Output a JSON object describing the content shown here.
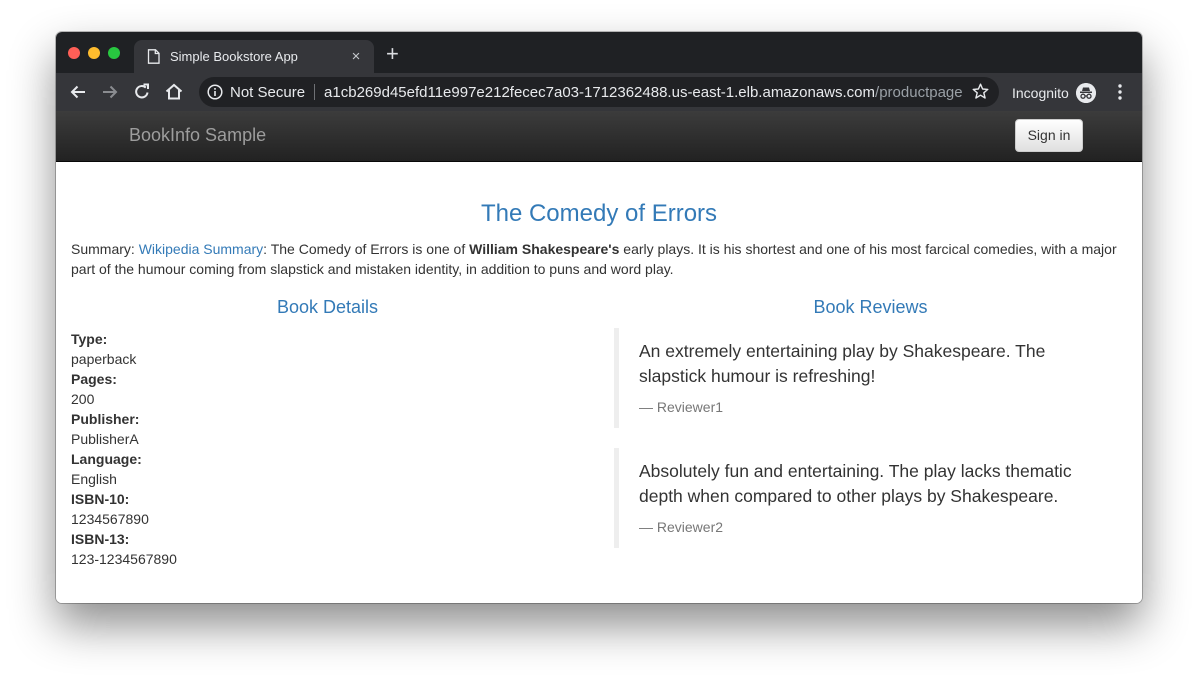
{
  "browser": {
    "tab_title": "Simple Bookstore App",
    "tab_close": "×",
    "new_tab": "+",
    "security_label": "Not Secure",
    "url_host": "a1cb269d45efd11e997e212fecec7a03-1712362488.us-east-1.elb.amazonaws.com",
    "url_path": "/productpage",
    "incognito_label": "Incognito",
    "traffic_light_colors": [
      "#ff5f57",
      "#febc2e",
      "#28c840"
    ]
  },
  "navbar": {
    "brand": "BookInfo Sample",
    "signin_label": "Sign in"
  },
  "book": {
    "title": "The Comedy of Errors",
    "summary_prefix": "Summary: ",
    "summary_link": "Wikipedia Summary",
    "summary_mid": ": The Comedy of Errors is one of ",
    "summary_author": "William Shakespeare's",
    "summary_rest": " early plays. It is his shortest and one of his most farcical comedies, with a major part of the humour coming from slapstick and mistaken identity, in addition to puns and word play."
  },
  "details": {
    "heading": "Book Details",
    "fields": [
      {
        "label": "Type:",
        "value": "paperback"
      },
      {
        "label": "Pages:",
        "value": "200"
      },
      {
        "label": "Publisher:",
        "value": "PublisherA"
      },
      {
        "label": "Language:",
        "value": "English"
      },
      {
        "label": "ISBN-10:",
        "value": "1234567890"
      },
      {
        "label": "ISBN-13:",
        "value": "123-1234567890"
      }
    ]
  },
  "reviews": {
    "heading": "Book Reviews",
    "items": [
      {
        "text": "An extremely entertaining play by Shakespeare. The slapstick humour is refreshing!",
        "author": "— Reviewer1"
      },
      {
        "text": "Absolutely fun and entertaining. The play lacks thematic depth when compared to other plays by Shakespeare.",
        "author": "— Reviewer2"
      }
    ]
  }
}
